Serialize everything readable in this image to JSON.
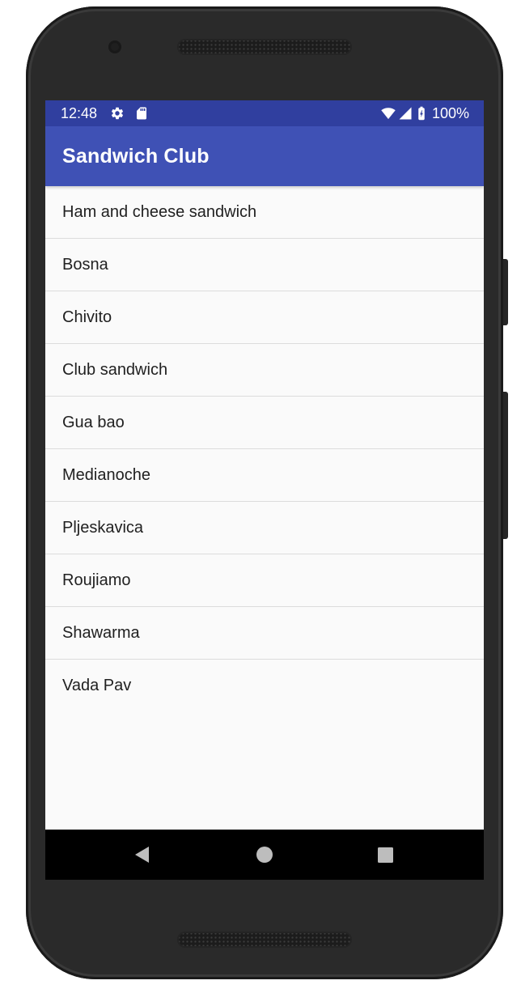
{
  "status_bar": {
    "time": "12:48",
    "icons": [
      "gear-icon",
      "sd-card-icon",
      "wifi-icon",
      "cell-signal-icon",
      "battery-icon"
    ],
    "battery_text": "100%",
    "color": "#303f9f"
  },
  "app_bar": {
    "title": "Sandwich Club",
    "color": "#3f51b5"
  },
  "sandwich_list": {
    "items": [
      {
        "label": "Ham and cheese sandwich"
      },
      {
        "label": "Bosna"
      },
      {
        "label": "Chivito"
      },
      {
        "label": "Club sandwich"
      },
      {
        "label": "Gua bao"
      },
      {
        "label": "Medianoche"
      },
      {
        "label": "Pljeskavica"
      },
      {
        "label": "Roujiamo"
      },
      {
        "label": "Shawarma"
      },
      {
        "label": "Vada Pav"
      }
    ]
  },
  "nav_bar": {
    "buttons": [
      "back-icon",
      "home-icon",
      "recents-icon"
    ]
  }
}
